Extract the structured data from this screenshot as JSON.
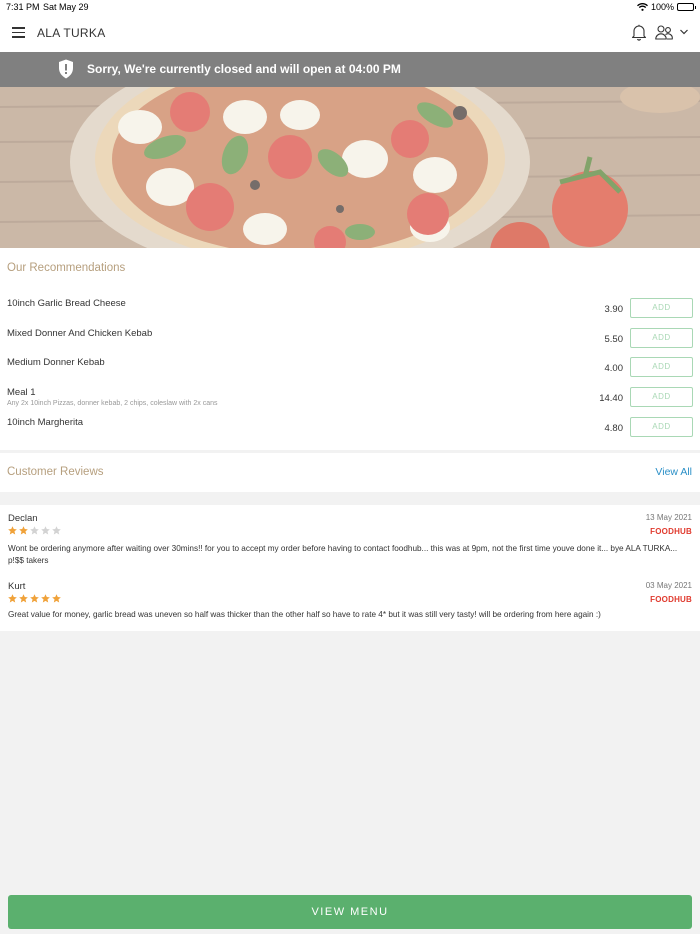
{
  "status_bar": {
    "time": "7:31 PM",
    "date": "Sat May 29",
    "battery": "100%",
    "battery_level": 1.0
  },
  "header": {
    "title": "ALA TURKA"
  },
  "banner": {
    "message": "Sorry, We're currently closed and will open at 04:00 PM"
  },
  "recommendations": {
    "title": "Our Recommendations",
    "add_label": "ADD",
    "items": [
      {
        "name": "10inch Garlic Bread Cheese",
        "description": "",
        "price": "3.90"
      },
      {
        "name": "Mixed Donner And Chicken Kebab",
        "description": "",
        "price": "5.50"
      },
      {
        "name": "Medium Donner Kebab",
        "description": "",
        "price": "4.00"
      },
      {
        "name": "Meal 1",
        "description": "Any 2x 10inch Pizzas, donner kebab, 2 chips, coleslaw with 2x cans",
        "price": "14.40"
      },
      {
        "name": "10inch Margherita",
        "description": "",
        "price": "4.80"
      }
    ]
  },
  "reviews": {
    "title": "Customer Reviews",
    "view_all": "View All",
    "items": [
      {
        "name": "Declan",
        "date": "13 May 2021",
        "rating": 2,
        "max_rating": 5,
        "source": "FOODHUB",
        "text": "Wont be ordering anymore after waiting over 30mins!! for you to accept my order before having to contact foodhub... this was at 9pm, not the first time youve done it... bye ALA TURKA... p!$$ takers"
      },
      {
        "name": "Kurt",
        "date": "03 May 2021",
        "rating": 5,
        "max_rating": 5,
        "source": "FOODHUB",
        "text": "Great value for money, garlic bread was uneven so half was thicker than the other half so have to rate 4* but it was still very tasty! will be ordering from here again :)"
      }
    ]
  },
  "footer": {
    "button_label": "VIEW MENU"
  },
  "colors": {
    "accent_green": "#5bb06e",
    "star_filled": "#f0a23a",
    "star_empty": "#d3d3d3",
    "link_blue": "#2a8fc7",
    "banner_gray": "#808080",
    "foodhub_red": "#e03a2e"
  }
}
